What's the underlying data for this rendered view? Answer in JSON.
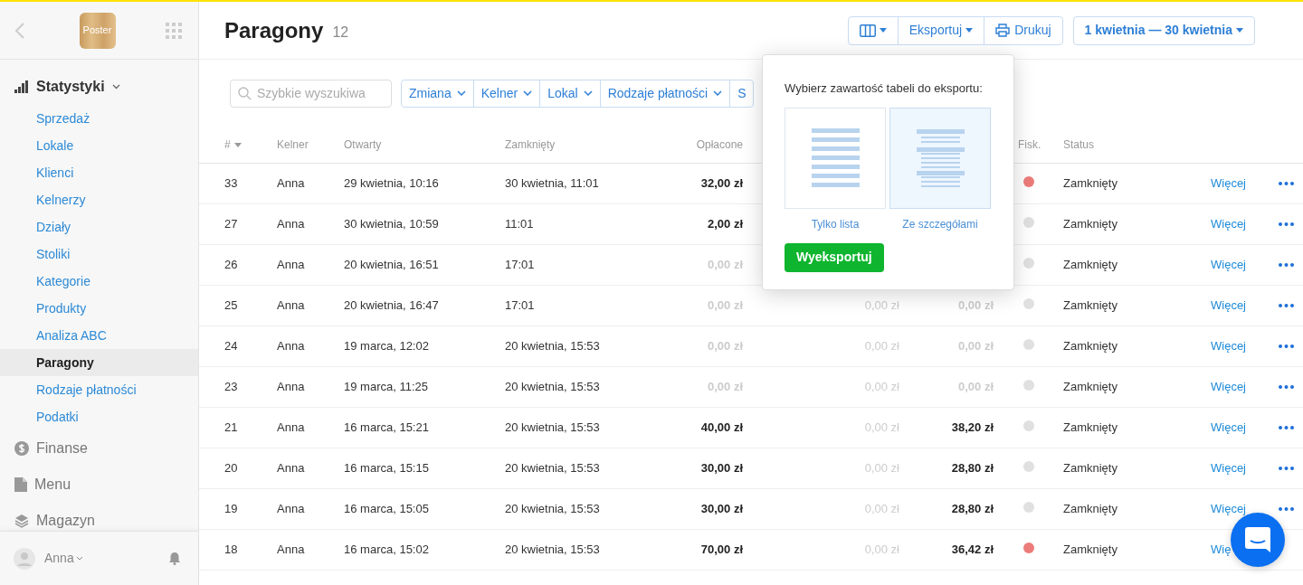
{
  "sidebar": {
    "logo": "Poster",
    "sections": [
      {
        "label": "Statystyki",
        "expanded": true,
        "children": [
          {
            "label": "Sprzedaż",
            "selected": false
          },
          {
            "label": "Lokale",
            "selected": false
          },
          {
            "label": "Klienci",
            "selected": false
          },
          {
            "label": "Kelnerzy",
            "selected": false
          },
          {
            "label": "Działy",
            "selected": false
          },
          {
            "label": "Stoliki",
            "selected": false
          },
          {
            "label": "Kategorie",
            "selected": false
          },
          {
            "label": "Produkty",
            "selected": false
          },
          {
            "label": "Analiza ABC",
            "selected": false
          },
          {
            "label": "Paragony",
            "selected": true
          },
          {
            "label": "Rodzaje płatności",
            "selected": false
          },
          {
            "label": "Podatki",
            "selected": false
          }
        ]
      },
      {
        "label": "Finanse",
        "expanded": false
      },
      {
        "label": "Menu",
        "expanded": false
      },
      {
        "label": "Magazyn",
        "expanded": false
      }
    ],
    "user": "Anna"
  },
  "header": {
    "title": "Paragony",
    "count": "12",
    "export": "Eksportuj",
    "print": "Drukuj",
    "date_range": "1 kwietnia — 30 kwietnia"
  },
  "search": {
    "placeholder": "Szybkie wyszukiwa"
  },
  "filters": [
    "Zmiana",
    "Kelner",
    "Lokal",
    "Rodzaje płatności",
    "S"
  ],
  "export_popover": {
    "title": "Wybierz zawartość tabeli do eksportu:",
    "options": [
      {
        "label": "Tylko lista",
        "selected": false
      },
      {
        "label": "Ze szczegółami",
        "selected": true
      }
    ],
    "button": "Wyeksportuj"
  },
  "table": {
    "columns": [
      "#",
      "Kelner",
      "Otwarty",
      "Zamknięty",
      "Opłacone",
      "Fisk.",
      "Status"
    ],
    "rows": [
      {
        "id": "33",
        "waiter": "Anna",
        "opened": "29 kwietnia, 10:16",
        "closed": "30 kwietnia, 11:01",
        "paid": {
          "text": "32,00 zł",
          "muted": false
        },
        "color": "#ec7c7a",
        "status": "Zamknięty",
        "link": "Więcej",
        "more_button": true
      },
      {
        "id": "27",
        "waiter": "Anna",
        "opened": "30 kwietnia, 10:59",
        "closed": "11:01",
        "paid": {
          "text": "2,00 zł",
          "muted": false
        },
        "color": "#e0e0e0",
        "status": "Zamknięty",
        "link": "Więcej",
        "more_button": true
      },
      {
        "id": "26",
        "waiter": "Anna",
        "opened": "20 kwietnia, 16:51",
        "closed": "17:01",
        "paid": {
          "text": "0,00 zł",
          "muted": true
        },
        "color": "#e0e0e0",
        "status": "Zamknięty",
        "link": "Więcej",
        "more_button": true
      },
      {
        "id": "25",
        "waiter": "Anna",
        "opened": "20 kwietnia, 16:47",
        "closed": "17:01",
        "paid": {
          "text": "0,00 zł",
          "muted": true
        },
        "column_6": "0,00 zł",
        "column_7": {
          "text": "0,00 zł",
          "muted": true
        },
        "color": "#e0e0e0",
        "status": "Zamknięty",
        "link": "Więcej",
        "more_button": true
      },
      {
        "id": "24",
        "waiter": "Anna",
        "opened": "19 marca, 12:02",
        "closed": "20 kwietnia, 15:53",
        "paid": {
          "text": "0,00 zł",
          "muted": true
        },
        "column_6": "0,00 zł",
        "column_7": {
          "text": "0,00 zł",
          "muted": true
        },
        "color": "#e0e0e0",
        "status": "Zamknięty",
        "link": "Więcej",
        "more_button": true
      },
      {
        "id": "23",
        "waiter": "Anna",
        "opened": "19 marca, 11:25",
        "closed": "20 kwietnia, 15:53",
        "paid": {
          "text": "0,00 zł",
          "muted": true
        },
        "column_6": "0,00 zł",
        "column_7": {
          "text": "0,00 zł",
          "muted": true
        },
        "color": "#e0e0e0",
        "status": "Zamknięty",
        "link": "Więcej",
        "more_button": true
      },
      {
        "id": "21",
        "waiter": "Anna",
        "opened": "16 marca, 15:21",
        "closed": "20 kwietnia, 15:53",
        "paid": {
          "text": "40,00 zł",
          "muted": false
        },
        "column_6": "0,00 zł",
        "column_7": {
          "text": "38,20 zł",
          "muted": false
        },
        "color": "#e0e0e0",
        "status": "Zamknięty",
        "link": "Więcej",
        "more_button": true
      },
      {
        "id": "20",
        "waiter": "Anna",
        "opened": "16 marca, 15:15",
        "closed": "20 kwietnia, 15:53",
        "paid": {
          "text": "30,00 zł",
          "muted": false
        },
        "column_6": "0,00 zł",
        "column_7": {
          "text": "28,80 zł",
          "muted": false
        },
        "color": "#e0e0e0",
        "status": "Zamknięty",
        "link": "Więcej",
        "more_button": true
      },
      {
        "id": "19",
        "waiter": "Anna",
        "opened": "16 marca, 15:05",
        "closed": "20 kwietnia, 15:53",
        "paid": {
          "text": "30,00 zł",
          "muted": false
        },
        "column_6": "0,00 zł",
        "column_7": {
          "text": "28,80 zł",
          "muted": false
        },
        "color": "#e0e0e0",
        "status": "Zamknięty",
        "link": "Więcej",
        "more_button": true
      },
      {
        "id": "18",
        "waiter": "Anna",
        "opened": "16 marca, 15:02",
        "closed": "20 kwietnia, 15:53",
        "paid": {
          "text": "70,00 zł",
          "muted": false
        },
        "column_6": "0,00 zł",
        "column_7": {
          "text": "36,42 zł",
          "muted": false
        },
        "color": "#ec7c7a",
        "status": "Zamknięty",
        "link": "Wię",
        "more_button": false
      }
    ]
  }
}
